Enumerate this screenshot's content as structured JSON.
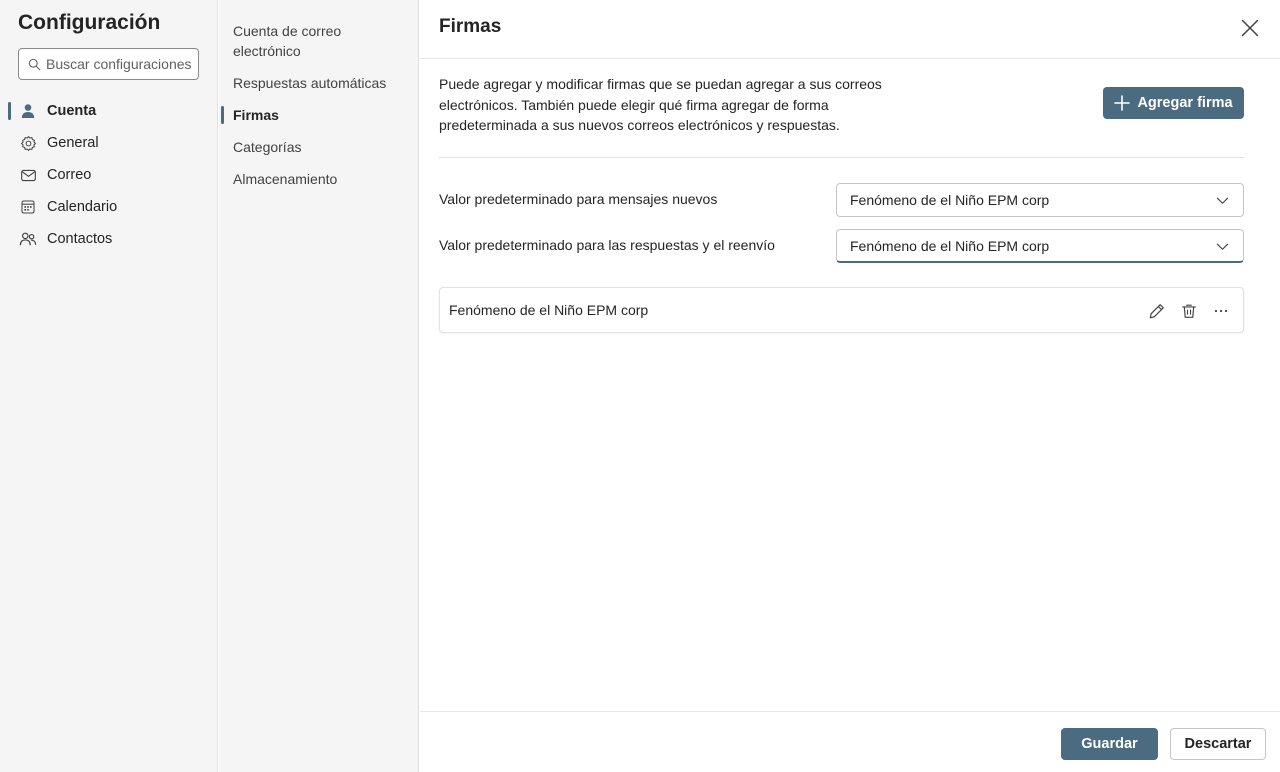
{
  "nav": {
    "title": "Configuración",
    "search": {
      "placeholder": "Buscar configuraciones",
      "value": "",
      "icon": "search-icon"
    },
    "items": [
      {
        "label": "Cuenta",
        "icon": "person-icon",
        "active": true
      },
      {
        "label": "General",
        "icon": "gear-icon",
        "active": false
      },
      {
        "label": "Correo",
        "icon": "mail-icon",
        "active": false
      },
      {
        "label": "Calendario",
        "icon": "calendar-icon",
        "active": false
      },
      {
        "label": "Contactos",
        "icon": "contacts-icon",
        "active": false
      }
    ]
  },
  "subnav": {
    "items": [
      {
        "label": "Cuenta de correo electrónico",
        "active": false
      },
      {
        "label": "Respuestas automáticas",
        "active": false
      },
      {
        "label": "Firmas",
        "active": true
      },
      {
        "label": "Categorías",
        "active": false
      },
      {
        "label": "Almacenamiento",
        "active": false
      }
    ]
  },
  "main": {
    "title": "Firmas",
    "close_icon": "close-icon",
    "description": "Puede agregar y modificar firmas que se puedan agregar a sus correos electrónicos. También puede elegir qué firma agregar de forma predeterminada a sus nuevos correos electrónicos y respuestas.",
    "add_button": {
      "label": "Agregar firma",
      "icon": "plus-icon"
    },
    "defaults": [
      {
        "label": "Valor predeterminado para mensajes nuevos",
        "selected": "Fenómeno de el Niño EPM corp"
      },
      {
        "label": "Valor predeterminado para las respuestas y el reenvío",
        "selected": "Fenómeno de el Niño EPM corp"
      }
    ],
    "signatures": [
      {
        "name": "Fenómeno de el Niño EPM corp",
        "actions": [
          "edit-icon",
          "delete-icon",
          "more-icon"
        ]
      }
    ]
  },
  "footer": {
    "save_label": "Guardar",
    "discard_label": "Descartar"
  },
  "colors": {
    "accent": "#4a6b80",
    "nav_background": "#f5f5f5",
    "text": "#242424"
  }
}
